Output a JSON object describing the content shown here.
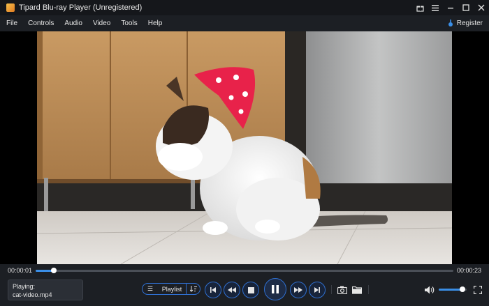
{
  "window": {
    "title": "Tipard Blu-ray Player (Unregistered)"
  },
  "menu": {
    "items": [
      "File",
      "Controls",
      "Audio",
      "Video",
      "Tools",
      "Help"
    ],
    "register_label": "Register"
  },
  "video": {
    "description": "Calico cat wearing a red pawprint bandana grooming its face on a tiled kitchen floor"
  },
  "playback": {
    "current_time": "00:00:01",
    "total_time": "00:00:23",
    "progress": 0.043,
    "volume": 0.85
  },
  "now_playing": {
    "label": "Playing:",
    "file": "cat-video.mp4"
  },
  "controls": {
    "playlist_label": "Playlist",
    "buttons": [
      "previous-icon",
      "rewind-icon",
      "stop-icon",
      "pause-icon",
      "fast-forward-icon",
      "next-icon",
      "camera-icon",
      "folder-icon",
      "volume-icon",
      "fullscreen-icon"
    ]
  },
  "colors": {
    "accent": "#3a8ee6",
    "background": "#1c1f24",
    "titlebar": "#15171b"
  }
}
